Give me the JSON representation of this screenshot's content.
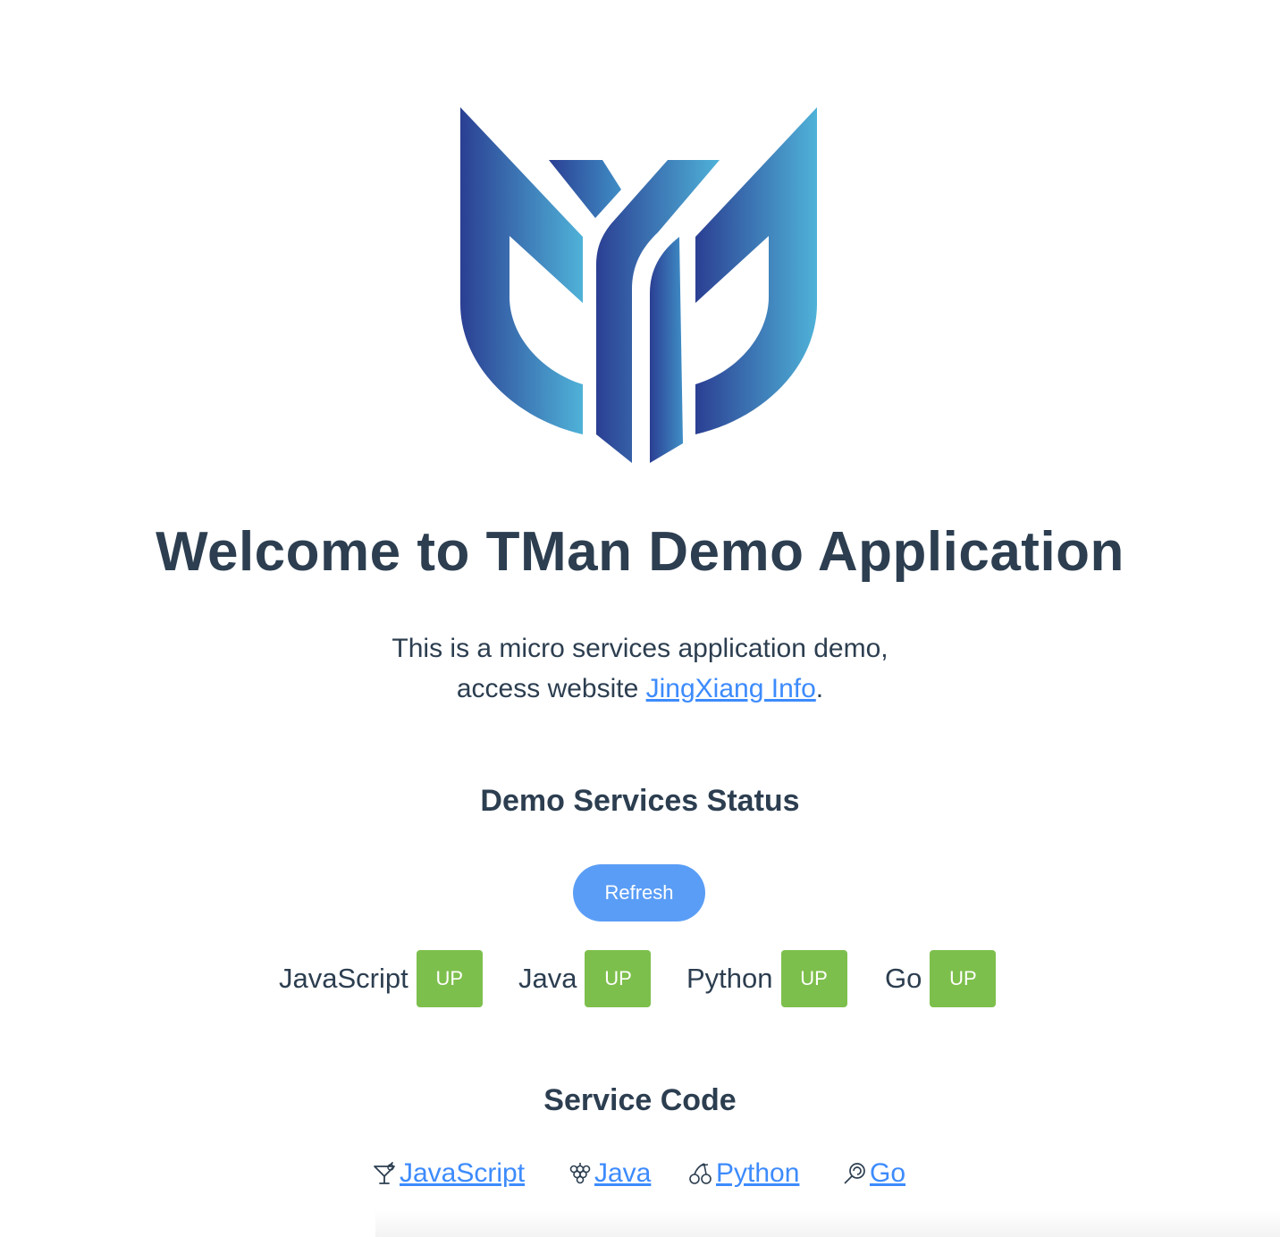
{
  "logo": {
    "name": "tman-logo",
    "colors": [
      "#2b3f93",
      "#4fb2d8"
    ]
  },
  "title": "Welcome to TMan Demo Application",
  "intro": {
    "line1": "This is a micro services application demo,",
    "line2_prefix": "access website ",
    "link_text": "JingXiang Info",
    "line2_suffix": "."
  },
  "status_section": {
    "heading": "Demo Services Status",
    "refresh_label": "Refresh",
    "services": [
      {
        "name": "JavaScript",
        "status": "UP"
      },
      {
        "name": "Java",
        "status": "UP"
      },
      {
        "name": "Python",
        "status": "UP"
      },
      {
        "name": "Go",
        "status": "UP"
      }
    ],
    "status_color": "#7dbf4c",
    "button_color": "#5a9df6"
  },
  "code_section": {
    "heading": "Service Code",
    "links": [
      {
        "label": "JavaScript",
        "icon": "cocktail-icon"
      },
      {
        "label": "Java",
        "icon": "grapes-icon"
      },
      {
        "label": "Python",
        "icon": "cherries-icon"
      },
      {
        "label": "Go",
        "icon": "lollipop-icon"
      }
    ],
    "link_color": "#3d8bfd"
  }
}
